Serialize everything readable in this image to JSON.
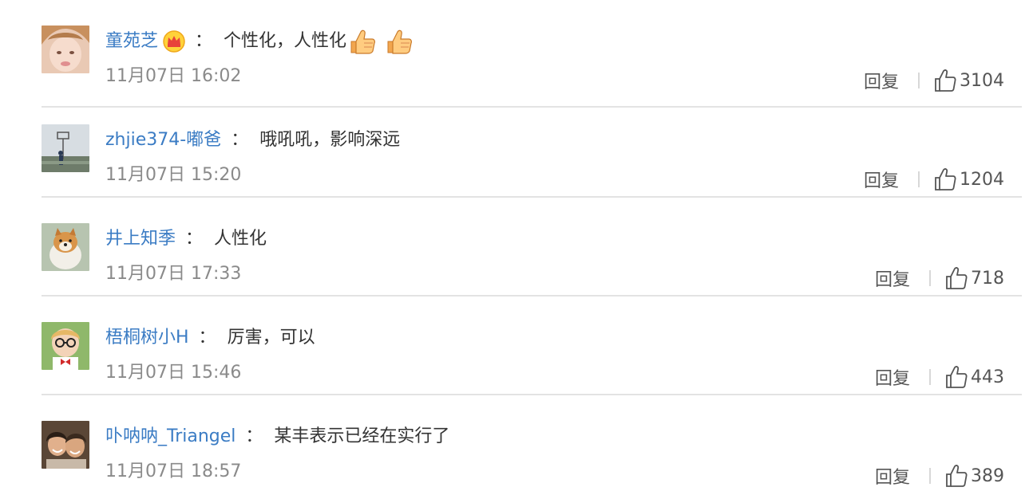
{
  "comments": [
    {
      "username": "童苑芝",
      "colon": "：",
      "text": "个性化，人性化",
      "time": "11月07日 16:02",
      "reply_label": "回复",
      "like_count": "3104"
    },
    {
      "username": "zhjie374-嘟爸",
      "colon": "：",
      "text": "哦吼吼，影响深远",
      "time": "11月07日 15:20",
      "reply_label": "回复",
      "like_count": "1204"
    },
    {
      "username": "井上知季",
      "colon": "：",
      "text": "人性化",
      "time": "11月07日 17:33",
      "reply_label": "回复",
      "like_count": "718"
    },
    {
      "username": "梧桐树小H",
      "colon": "：",
      "text": "厉害，可以",
      "time": "11月07日 15:46",
      "reply_label": "回复",
      "like_count": "443"
    },
    {
      "username": "卟呐呐_Triangel",
      "colon": "：",
      "text": "某丰表示已经在实行了",
      "time": "11月07日 18:57",
      "reply_label": "回复",
      "like_count": "389"
    }
  ],
  "colors": {
    "username": "#3b7cc4",
    "text": "#333333",
    "time": "#8a8a8a",
    "divider": "#e3e3e3"
  },
  "icons": {
    "badge": "crown-icon",
    "emoji": "thumbs-up-emoji-icon",
    "like": "thumbs-up-outline-icon"
  }
}
